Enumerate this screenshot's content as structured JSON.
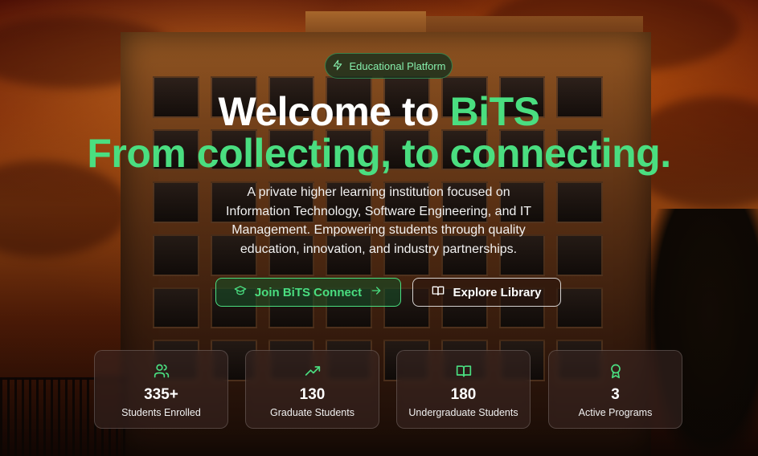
{
  "hero": {
    "badge_label": "Educational Platform",
    "badge_icon": "lightning-icon",
    "title_prefix": "Welcome to ",
    "title_accent": "BiTS",
    "tagline": "From collecting, to connecting.",
    "description": "A private higher learning institution focused on Information Technology, Software Engineering, and IT Management. Empowering students through quality education, innovation, and industry partnerships."
  },
  "actions": {
    "join_label": "Join BiTS Connect",
    "join_icon": "graduation-cap-icon",
    "join_arrow_icon": "arrow-right-icon",
    "library_label": "Explore Library",
    "library_icon": "book-open-icon"
  },
  "stats": [
    {
      "value": "335+",
      "label": "Students Enrolled",
      "icon": "users-icon"
    },
    {
      "value": "130",
      "label": "Graduate Students",
      "icon": "trending-up-icon"
    },
    {
      "value": "180",
      "label": "Undergraduate Students",
      "icon": "book-open-icon"
    },
    {
      "value": "3",
      "label": "Active Programs",
      "icon": "award-icon"
    }
  ],
  "colors": {
    "accent": "#4ade80",
    "badge_text": "#86efac",
    "text": "#ffffff"
  }
}
